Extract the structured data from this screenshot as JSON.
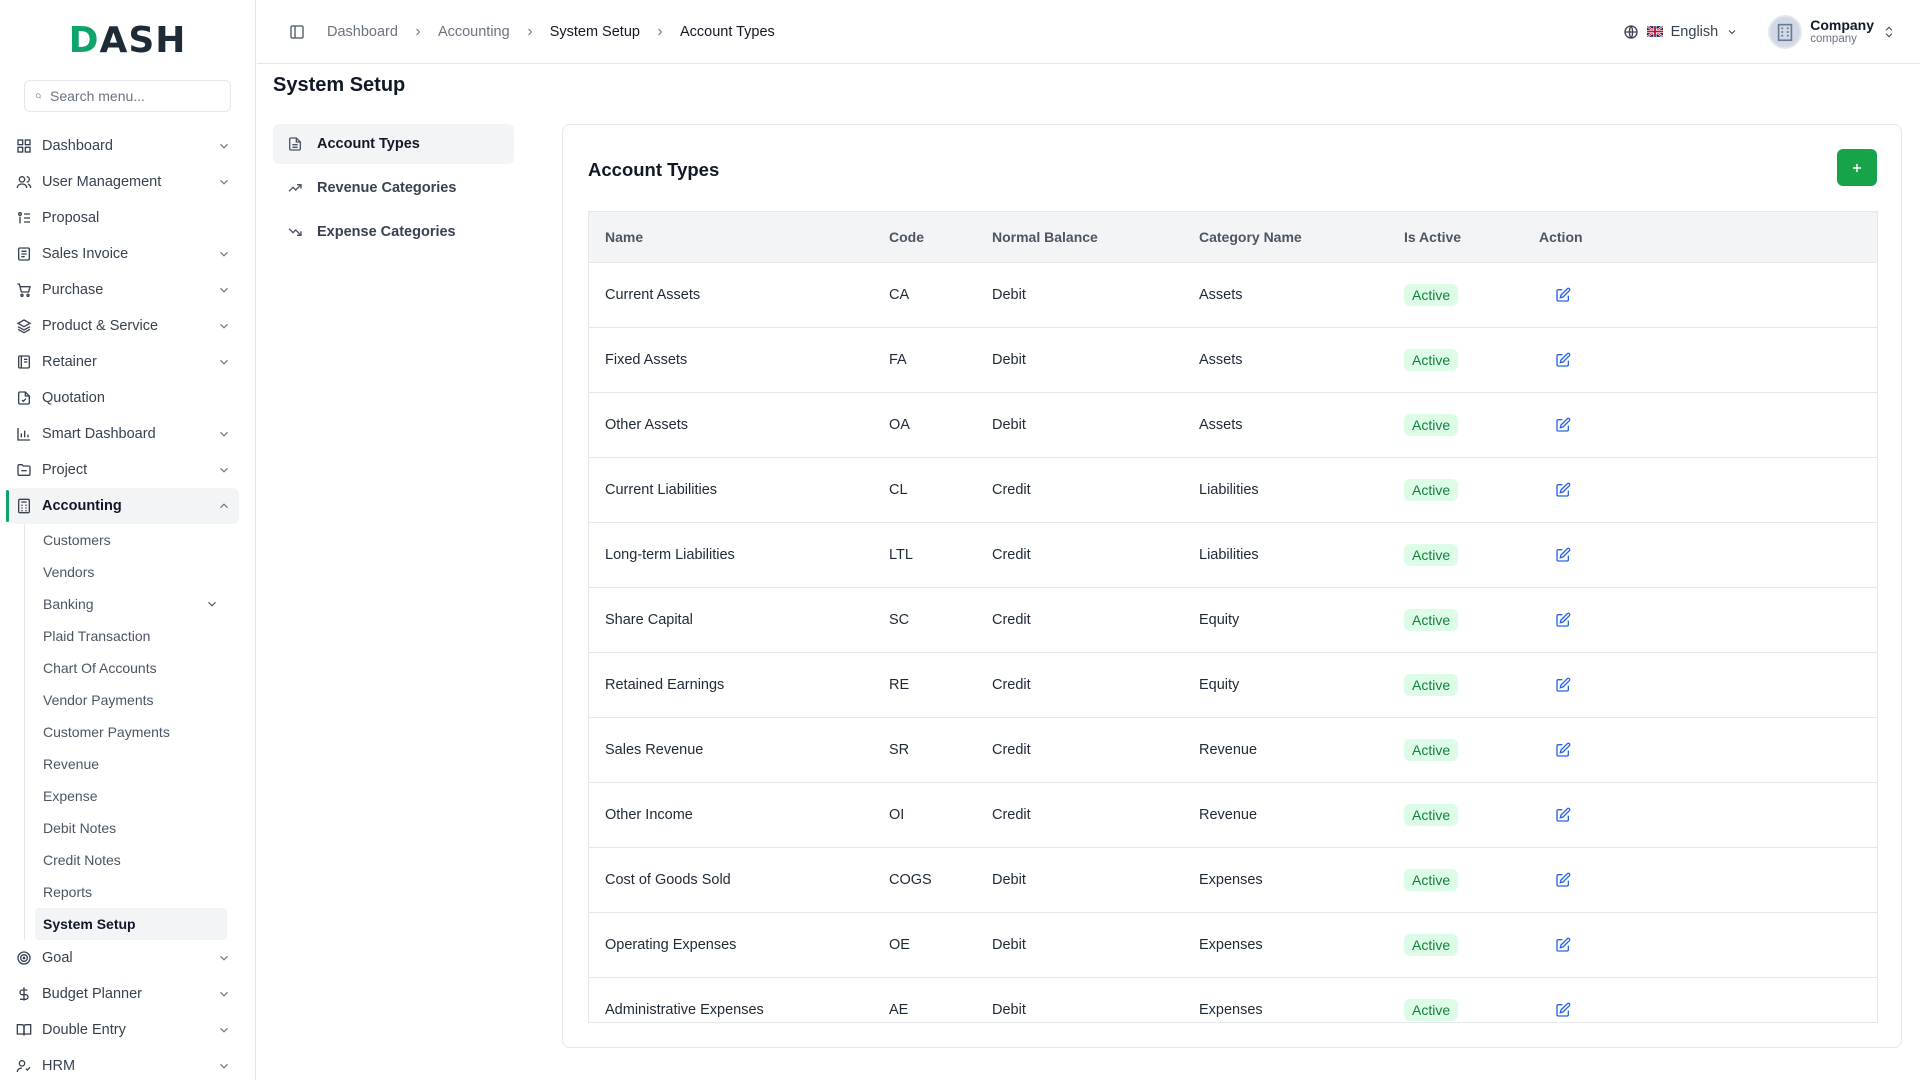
{
  "brand": {
    "logo_text": "DASH",
    "logo_first": "D",
    "logo_rest": "ASH",
    "accent": "#0ea46a"
  },
  "search": {
    "placeholder": "Search menu..."
  },
  "sidebar": {
    "items": [
      {
        "label": "Dashboard",
        "icon": "grid-icon"
      },
      {
        "label": "User Management",
        "icon": "users-icon"
      },
      {
        "label": "Proposal",
        "icon": "proposal-icon"
      },
      {
        "label": "Sales Invoice",
        "icon": "invoice-icon"
      },
      {
        "label": "Purchase",
        "icon": "cart-icon"
      },
      {
        "label": "Product & Service",
        "icon": "layers-icon"
      },
      {
        "label": "Retainer",
        "icon": "retainer-icon"
      },
      {
        "label": "Quotation",
        "icon": "file-icon"
      },
      {
        "label": "Smart Dashboard",
        "icon": "bar-chart-icon"
      },
      {
        "label": "Project",
        "icon": "folder-icon"
      },
      {
        "label": "Accounting",
        "icon": "calculator-icon"
      }
    ],
    "accounting_sub": [
      {
        "label": "Customers"
      },
      {
        "label": "Vendors"
      },
      {
        "label": "Banking"
      },
      {
        "label": "Plaid Transaction"
      },
      {
        "label": "Chart Of Accounts"
      },
      {
        "label": "Vendor Payments"
      },
      {
        "label": "Customer Payments"
      },
      {
        "label": "Revenue"
      },
      {
        "label": "Expense"
      },
      {
        "label": "Debit Notes"
      },
      {
        "label": "Credit Notes"
      },
      {
        "label": "Reports"
      },
      {
        "label": "System Setup"
      }
    ],
    "bottom_items": [
      {
        "label": "Goal",
        "icon": "target-icon"
      },
      {
        "label": "Budget Planner",
        "icon": "dollar-icon"
      },
      {
        "label": "Double Entry",
        "icon": "book-icon"
      },
      {
        "label": "HRM",
        "icon": "hrm-icon"
      }
    ]
  },
  "header": {
    "breadcrumbs": [
      "Dashboard",
      "Accounting",
      "System Setup",
      "Account Types"
    ],
    "language": "English",
    "company_name": "Company",
    "company_role": "company"
  },
  "page": {
    "title": "System Setup",
    "setup_menu": [
      {
        "label": "Account Types",
        "icon": "document-icon"
      },
      {
        "label": "Revenue Categories",
        "icon": "trending-up-icon"
      },
      {
        "label": "Expense Categories",
        "icon": "trending-down-icon"
      }
    ]
  },
  "card": {
    "title": "Account Types",
    "add_button": "+",
    "columns": [
      "Name",
      "Code",
      "Normal Balance",
      "Category Name",
      "Is Active",
      "Action"
    ],
    "rows": [
      {
        "name": "Current Assets",
        "code": "CA",
        "balance": "Debit",
        "category": "Assets",
        "status": "Active"
      },
      {
        "name": "Fixed Assets",
        "code": "FA",
        "balance": "Debit",
        "category": "Assets",
        "status": "Active"
      },
      {
        "name": "Other Assets",
        "code": "OA",
        "balance": "Debit",
        "category": "Assets",
        "status": "Active"
      },
      {
        "name": "Current Liabilities",
        "code": "CL",
        "balance": "Credit",
        "category": "Liabilities",
        "status": "Active"
      },
      {
        "name": "Long-term Liabilities",
        "code": "LTL",
        "balance": "Credit",
        "category": "Liabilities",
        "status": "Active"
      },
      {
        "name": "Share Capital",
        "code": "SC",
        "balance": "Credit",
        "category": "Equity",
        "status": "Active"
      },
      {
        "name": "Retained Earnings",
        "code": "RE",
        "balance": "Credit",
        "category": "Equity",
        "status": "Active"
      },
      {
        "name": "Sales Revenue",
        "code": "SR",
        "balance": "Credit",
        "category": "Revenue",
        "status": "Active"
      },
      {
        "name": "Other Income",
        "code": "OI",
        "balance": "Credit",
        "category": "Revenue",
        "status": "Active"
      },
      {
        "name": "Cost of Goods Sold",
        "code": "COGS",
        "balance": "Debit",
        "category": "Expenses",
        "status": "Active"
      },
      {
        "name": "Operating Expenses",
        "code": "OE",
        "balance": "Debit",
        "category": "Expenses",
        "status": "Active"
      },
      {
        "name": "Administrative Expenses",
        "code": "AE",
        "balance": "Debit",
        "category": "Expenses",
        "status": "Active"
      }
    ]
  }
}
